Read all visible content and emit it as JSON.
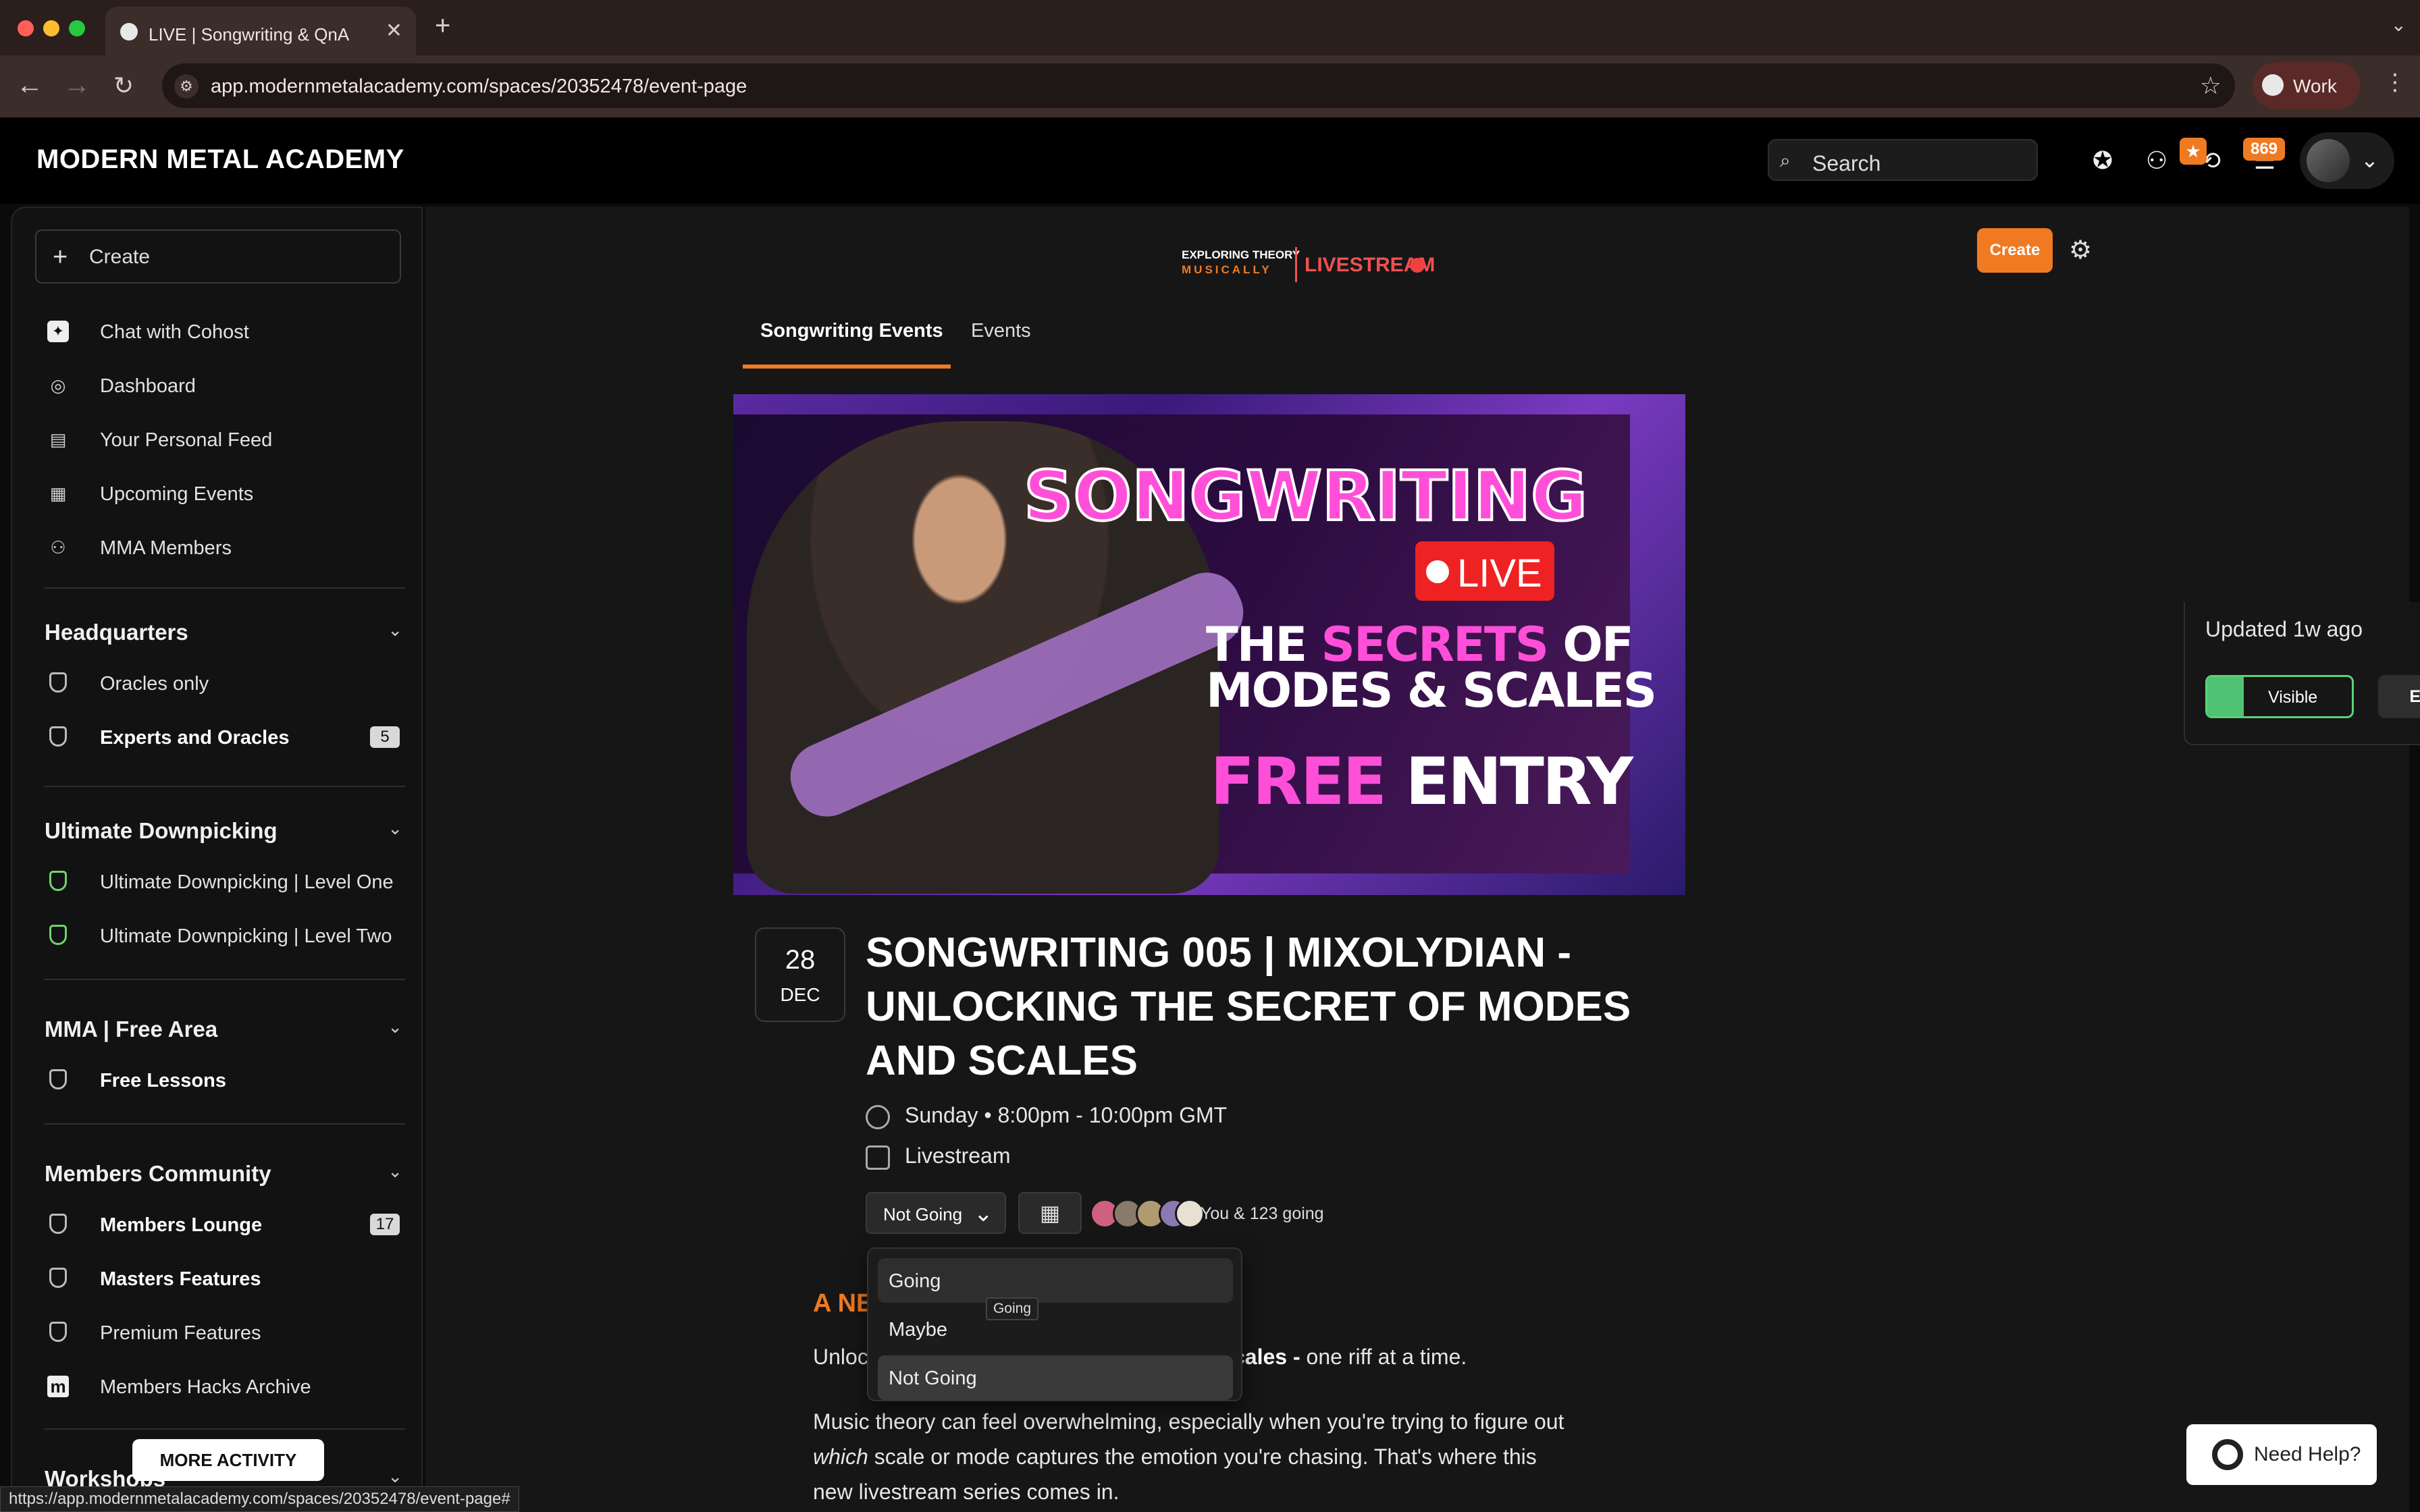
{
  "browser": {
    "tab_title": "LIVE | Songwriting & QnA",
    "url": "app.modernmetalacademy.com/spaces/20352478/event-page",
    "profile_label": "Work",
    "status_url": "https://app.modernmetalacademy.com/spaces/20352478/event-page#"
  },
  "header": {
    "logo": "MODERN METAL ACADEMY",
    "search_placeholder": "Search",
    "notification_count": "869"
  },
  "sidebar": {
    "create_label": "Create",
    "top_items": [
      {
        "label": "Chat with Cohost",
        "icon": "sparkle-icon"
      },
      {
        "label": "Dashboard",
        "icon": "compass-icon"
      },
      {
        "label": "Your Personal Feed",
        "icon": "feed-icon"
      },
      {
        "label": "Upcoming Events",
        "icon": "calendar-icon"
      },
      {
        "label": "MMA Members",
        "icon": "members-icon"
      }
    ],
    "groups": [
      {
        "title": "Headquarters",
        "items": [
          {
            "label": "Oracles only",
            "bold": false,
            "count": ""
          },
          {
            "label": "Experts and Oracles",
            "bold": true,
            "count": "5"
          }
        ]
      },
      {
        "title": "Ultimate Downpicking",
        "items": [
          {
            "label": "Ultimate Downpicking | Level One",
            "bold": false,
            "count": ""
          },
          {
            "label": "Ultimate Downpicking | Level Two",
            "bold": false,
            "count": ""
          }
        ]
      },
      {
        "title": "MMA | Free Area",
        "items": [
          {
            "label": "Free Lessons",
            "bold": true,
            "count": ""
          }
        ]
      },
      {
        "title": "Members Community",
        "items": [
          {
            "label": "Members Lounge",
            "bold": true,
            "count": "17"
          },
          {
            "label": "Masters Features",
            "bold": true,
            "count": ""
          },
          {
            "label": "Premium Features",
            "bold": false,
            "count": ""
          },
          {
            "label": "Members Hacks Archive",
            "bold": false,
            "count": ""
          }
        ]
      },
      {
        "title": "Workshops",
        "items": []
      }
    ],
    "more_activity": "MORE ACTIVITY"
  },
  "space": {
    "logo_line1": "EXPLORING THEORY",
    "logo_line2": "MUSICALLY",
    "logo_live": "LIVESTREAM",
    "create_label": "Create",
    "tabs": [
      {
        "label": "Songwriting Events",
        "active": true
      },
      {
        "label": "Events",
        "active": false
      }
    ]
  },
  "banner": {
    "title": "SONGWRITING",
    "live": "LIVE",
    "line1_a": "THE ",
    "line1_b": "SECRETS",
    "line1_c": " OF",
    "line2": "MODES & SCALES",
    "line3_a": "FREE",
    "line3_b": " ENTRY"
  },
  "event": {
    "day": "28",
    "month": "DEC",
    "title": "SONGWRITING 005 | MIXOLYDIAN - UNLOCKING THE SECRET OF MODES AND SCALES",
    "time": "Sunday • 8:00pm - 10:00pm GMT",
    "location": "Livestream",
    "rsvp_value": "Not Going",
    "going_text": "You & 123 going",
    "desc_heading_start": "A NE",
    "desc_heading_end": "!",
    "desc_line1_start": "Unloc",
    "desc_line1_bold": "cales -",
    "desc_line1_end": " one riff at a time.",
    "desc_p2_l1": "Music theory can feel overwhelming, especially when you're trying to figure out",
    "desc_p2_l2_italic": "which",
    "desc_p2_l2_rest": " scale or mode captures the emotion you're chasing. That's where this",
    "desc_p2_l3": "new livestream series comes in."
  },
  "rsvp_menu": {
    "options": [
      "Going",
      "Maybe",
      "Not Going"
    ],
    "tooltip": "Going"
  },
  "info_card": {
    "updated": "Updated 1w ago",
    "visible_label": "Visible",
    "edit_label": "Edit"
  },
  "help": {
    "label": "Need Help?"
  },
  "colors": {
    "accent": "#f07a22",
    "visible_green": "#4fc373"
  }
}
